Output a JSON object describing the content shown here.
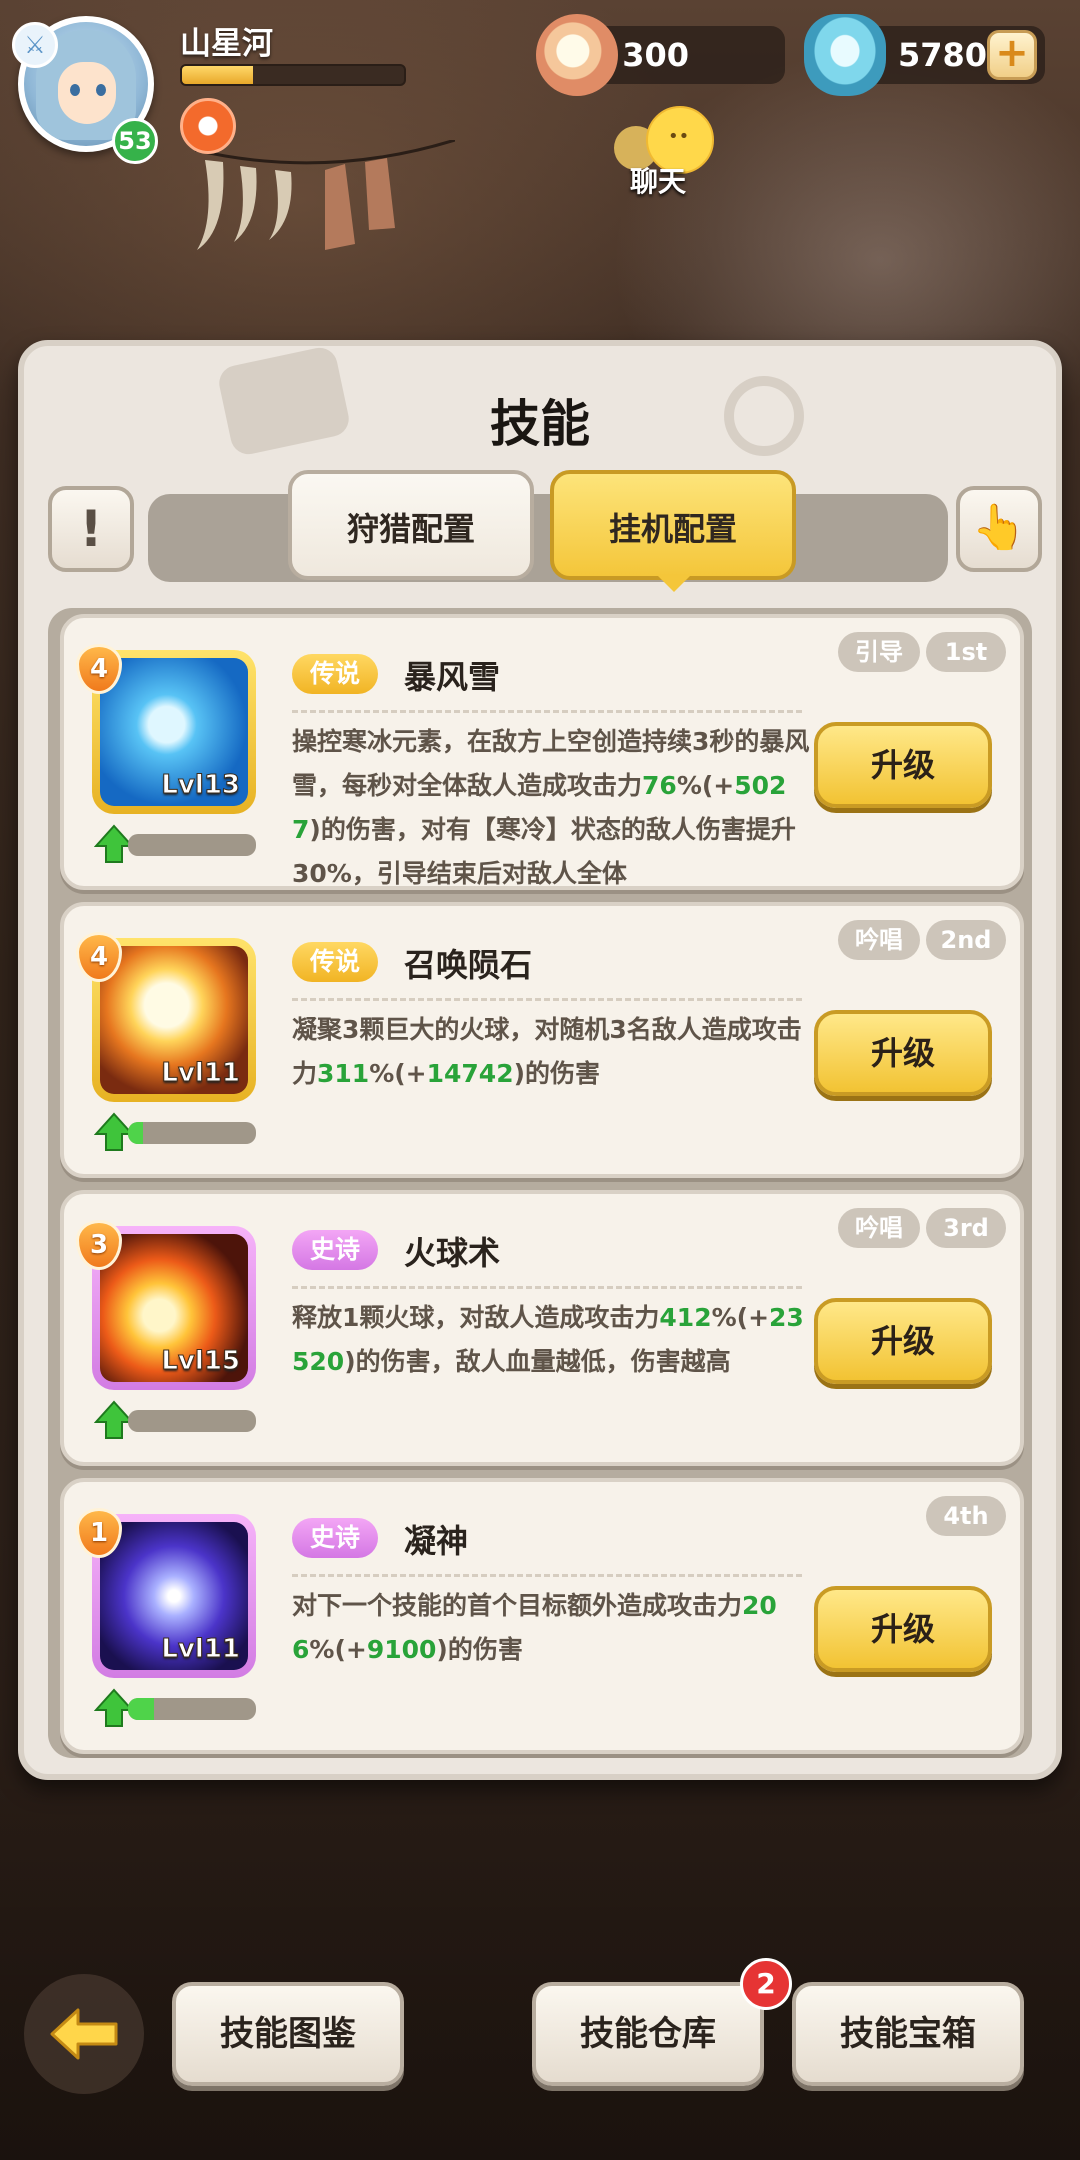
{
  "player": {
    "name": "山星河",
    "level": "53",
    "exp_fraction": 0.32
  },
  "currency": {
    "pearls": "300",
    "gems": "5780",
    "plus": "+"
  },
  "chat": {
    "label": "聊天"
  },
  "panel": {
    "title": "技能"
  },
  "controls": {
    "info": "!"
  },
  "tabs": [
    {
      "label": "狩猎配置",
      "active": false
    },
    {
      "label": "挂机配置",
      "active": true
    }
  ],
  "skills": [
    {
      "stars": "4",
      "icon_level": "Lvl13",
      "tier": "传说",
      "name": "暴风雪",
      "type_tag": "引导",
      "order_tag": "1st",
      "desc": [
        {
          "t": "操控寒冰元素，在敌方上空创造持续3秒的暴风雪，每秒对全体敌人造成攻击力"
        },
        {
          "t": "76",
          "g": true
        },
        {
          "t": "%(+"
        },
        {
          "t": "5027",
          "g": true
        },
        {
          "t": ")的伤害，对有【寒冷】状态的敌人伤害提升30%，引导结束后对敌人全体"
        }
      ],
      "progress": 0.0,
      "upgrade": "升级"
    },
    {
      "stars": "4",
      "icon_level": "Lvl11",
      "tier": "传说",
      "name": "召唤陨石",
      "type_tag": "吟唱",
      "order_tag": "2nd",
      "desc": [
        {
          "t": "凝聚3颗巨大的火球，对随机3名敌人造成攻击力"
        },
        {
          "t": "311",
          "g": true
        },
        {
          "t": "%(+"
        },
        {
          "t": "14742",
          "g": true
        },
        {
          "t": ")的伤害"
        }
      ],
      "progress": 0.12,
      "upgrade": "升级"
    },
    {
      "stars": "3",
      "icon_level": "Lvl15",
      "tier": "史诗",
      "name": "火球术",
      "type_tag": "吟唱",
      "order_tag": "3rd",
      "desc": [
        {
          "t": "释放1颗火球，对敌人造成攻击力"
        },
        {
          "t": "412",
          "g": true
        },
        {
          "t": "%(+"
        },
        {
          "t": "23520",
          "g": true
        },
        {
          "t": ")的伤害，敌人血量越低，伤害越高"
        }
      ],
      "progress": 0.0,
      "upgrade": "升级"
    },
    {
      "stars": "1",
      "icon_level": "Lvl11",
      "tier": "史诗",
      "name": "凝神",
      "type_tag": "",
      "order_tag": "4th",
      "desc": [
        {
          "t": "对下一个技能的首个目标额外造成攻击力"
        },
        {
          "t": "206",
          "g": true
        },
        {
          "t": "%(+"
        },
        {
          "t": "9100",
          "g": true
        },
        {
          "t": ")的伤害"
        }
      ],
      "progress": 0.2,
      "upgrade": "升级"
    }
  ],
  "bottom": {
    "codex": "技能图鉴",
    "storage": "技能仓库",
    "storage_badge": "2",
    "chest": "技能宝箱"
  },
  "colors": {
    "legend": "#f1b424",
    "epic": "#d477e4",
    "highlight_green": "#29a339",
    "accent_yellow": "#f2c333"
  }
}
